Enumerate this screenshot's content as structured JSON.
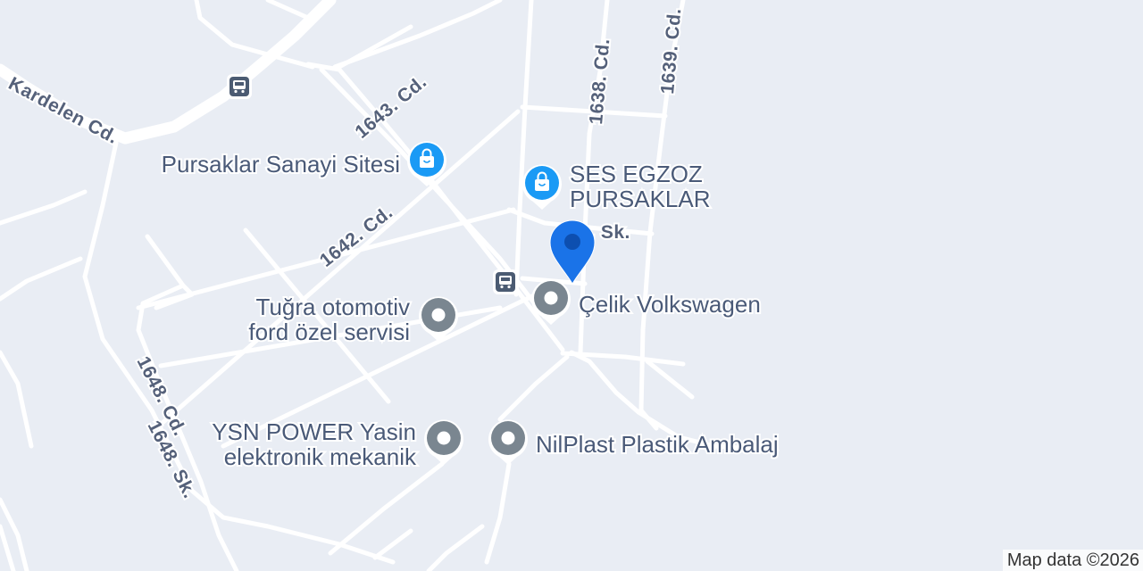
{
  "map": {
    "streets": {
      "kardelen": "Kardelen Cd.",
      "c1643": "1643. Cd.",
      "c1642": "1642. Cd.",
      "c1638": "1638. Cd.",
      "c1639": "1639. Cd.",
      "c1648": "1648. Cd.",
      "s1648": "1648. Sk.",
      "sk": "1. Sk."
    },
    "places": {
      "pursaklar_sanayi": {
        "name": "Pursaklar Sanayi Sitesi",
        "icon": "shopping-bag-icon"
      },
      "ses_egzoz": {
        "line1": "SES EGZOZ",
        "line2": "PURSAKLAR",
        "icon": "shopping-bag-icon"
      },
      "celik": {
        "name": "Çelik Volkswagen",
        "icon": "place-icon"
      },
      "tugra": {
        "line1": "Tuğra otomotiv",
        "line2": "ford özel servisi",
        "icon": "place-icon"
      },
      "ysn": {
        "line1": "YSN POWER Yasin",
        "line2": "elektronik mekanik",
        "icon": "place-icon"
      },
      "nilplast": {
        "name": "NilPlast Plastik Ambalaj",
        "icon": "place-icon"
      }
    },
    "transit": {
      "icon": "bus-stop-icon"
    },
    "marker": {
      "icon": "location-pin-icon",
      "color": "#1a73e8"
    },
    "colors": {
      "background": "#e9edf4",
      "road": "#ffffff",
      "shop_pin": "#1a9af5",
      "place_pin": "#7a8690"
    },
    "attribution": "Map data ©2026"
  }
}
